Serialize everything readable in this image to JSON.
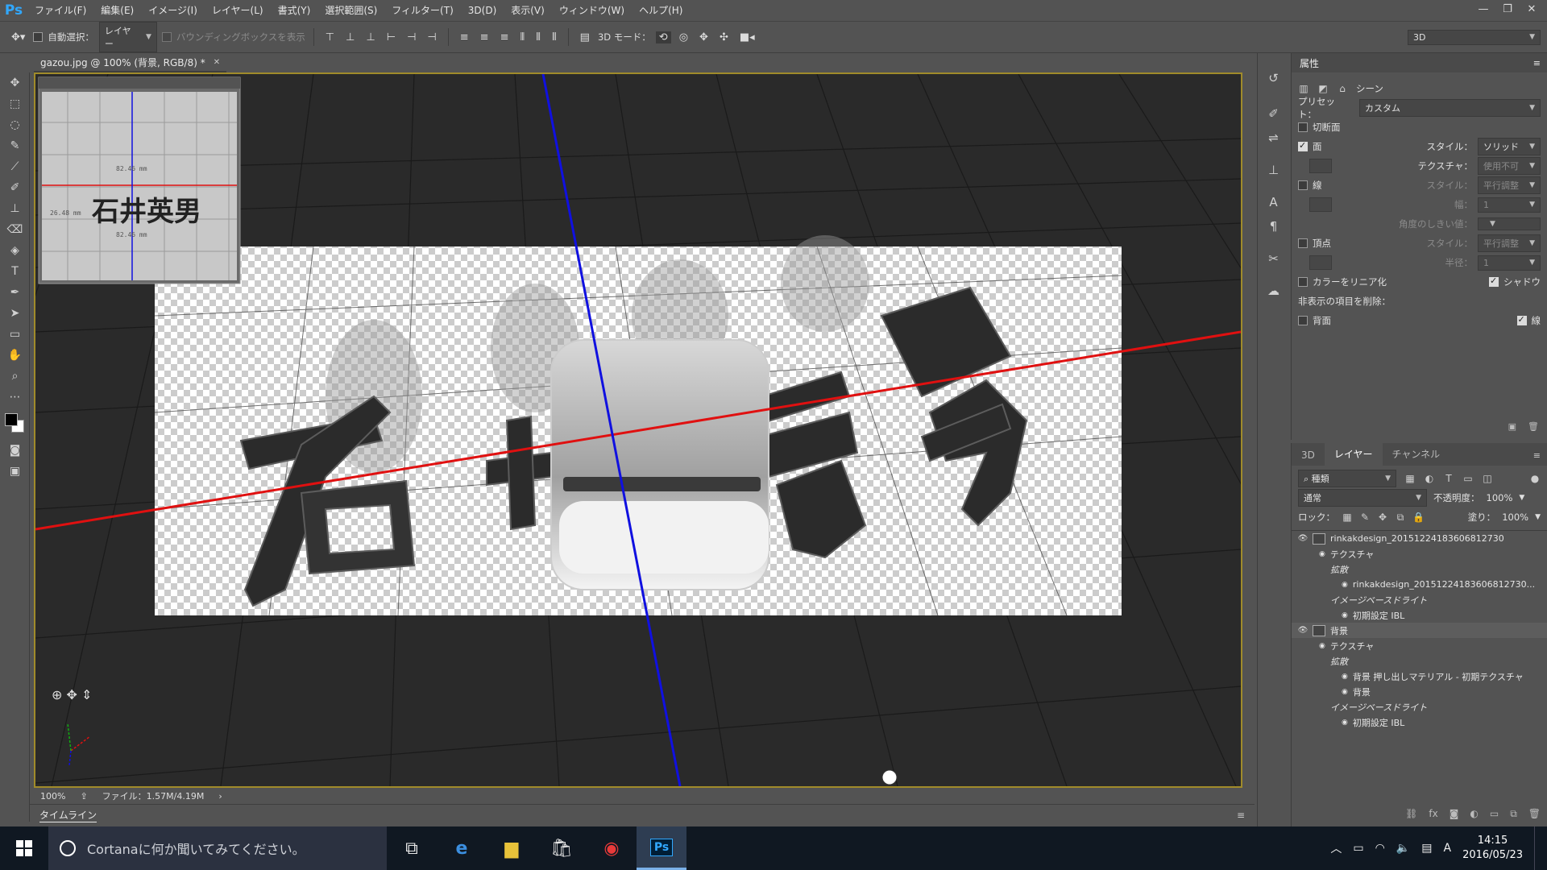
{
  "app": {
    "logo": "Ps",
    "accent": "#31a8ff"
  },
  "menu": [
    "ファイル(F)",
    "編集(E)",
    "イメージ(I)",
    "レイヤー(L)",
    "書式(Y)",
    "選択範囲(S)",
    "フィルター(T)",
    "3D(D)",
    "表示(V)",
    "ウィンドウ(W)",
    "ヘルプ(H)"
  ],
  "options": {
    "auto_select_label": "自動選択：",
    "auto_select_value": "レイヤー",
    "bbox_label": "バウンディングボックスを表示",
    "mode3d_label": "3D モード：",
    "workspace": "3D"
  },
  "document": {
    "tab_title": "gazou.jpg @ 100% (背景, RGB/8) *",
    "zoom": "100%",
    "file_info": "ファイル：1.57M/4.19M",
    "thumb_text": "石井英男",
    "thumb_dim_h": "82.46 mm",
    "thumb_dim_v": "26.48 mm",
    "grid_color": "#c8c8c8",
    "x_axis_color": "#e01010",
    "y_axis_color": "#1010e0"
  },
  "timeline_label": "タイムライン",
  "properties": {
    "title": "属性",
    "scene_label": "シーン",
    "preset_label": "プリセット：",
    "preset_value": "カスタム",
    "cross_section": "切断面",
    "surface": "面",
    "style_label": "スタイル：",
    "surface_style": "ソリッド",
    "texture_label": "テクスチャ：",
    "texture_value": "使用不可",
    "line": "線",
    "line_style": "平行調整",
    "width_label": "幅：",
    "width_value": "1",
    "angle_label": "角度のしきい値：",
    "vertex": "頂点",
    "vertex_style": "平行調整",
    "radius_label": "半径：",
    "radius_value": "1",
    "linearize": "カラーをリニア化",
    "shadow": "シャドウ",
    "remove_hidden": "非表示の項目を削除：",
    "backface": "背面",
    "lines": "線"
  },
  "layers_panel": {
    "tabs": [
      "3D",
      "レイヤー",
      "チャンネル"
    ],
    "kind_filter": "種類",
    "blend_mode": "通常",
    "opacity_label": "不透明度：",
    "opacity_value": "100%",
    "lock_label": "ロック：",
    "fill_label": "塗り：",
    "fill_value": "100%",
    "rows": [
      {
        "indent": 0,
        "eye": true,
        "thumb": true,
        "text": "rinkakdesign_20151224183606812730"
      },
      {
        "indent": 1,
        "eye": true,
        "thumb": false,
        "text": "テクスチャ"
      },
      {
        "indent": 2,
        "eye": false,
        "thumb": false,
        "text": "拡散"
      },
      {
        "indent": 3,
        "eye": true,
        "thumb": false,
        "text": "rinkakdesign_20151224183606812730..."
      },
      {
        "indent": 2,
        "eye": false,
        "thumb": false,
        "text": "イメージベースドライト"
      },
      {
        "indent": 3,
        "eye": true,
        "thumb": false,
        "text": "初期設定 IBL"
      },
      {
        "indent": 0,
        "eye": true,
        "thumb": true,
        "text": "背景",
        "selected": true
      },
      {
        "indent": 1,
        "eye": true,
        "thumb": false,
        "text": "テクスチャ"
      },
      {
        "indent": 2,
        "eye": false,
        "thumb": false,
        "text": "拡散"
      },
      {
        "indent": 3,
        "eye": true,
        "thumb": false,
        "text": "背景 押し出しマテリアル - 初期テクスチャ"
      },
      {
        "indent": 3,
        "eye": true,
        "thumb": false,
        "text": "背景"
      },
      {
        "indent": 2,
        "eye": false,
        "thumb": false,
        "text": "イメージベースドライト"
      },
      {
        "indent": 3,
        "eye": true,
        "thumb": false,
        "text": "初期設定 IBL"
      }
    ]
  },
  "taskbar": {
    "search_placeholder": "Cortanaに何か聞いてみてください。",
    "time": "14:15",
    "date": "2016/05/23",
    "ime": "A"
  }
}
